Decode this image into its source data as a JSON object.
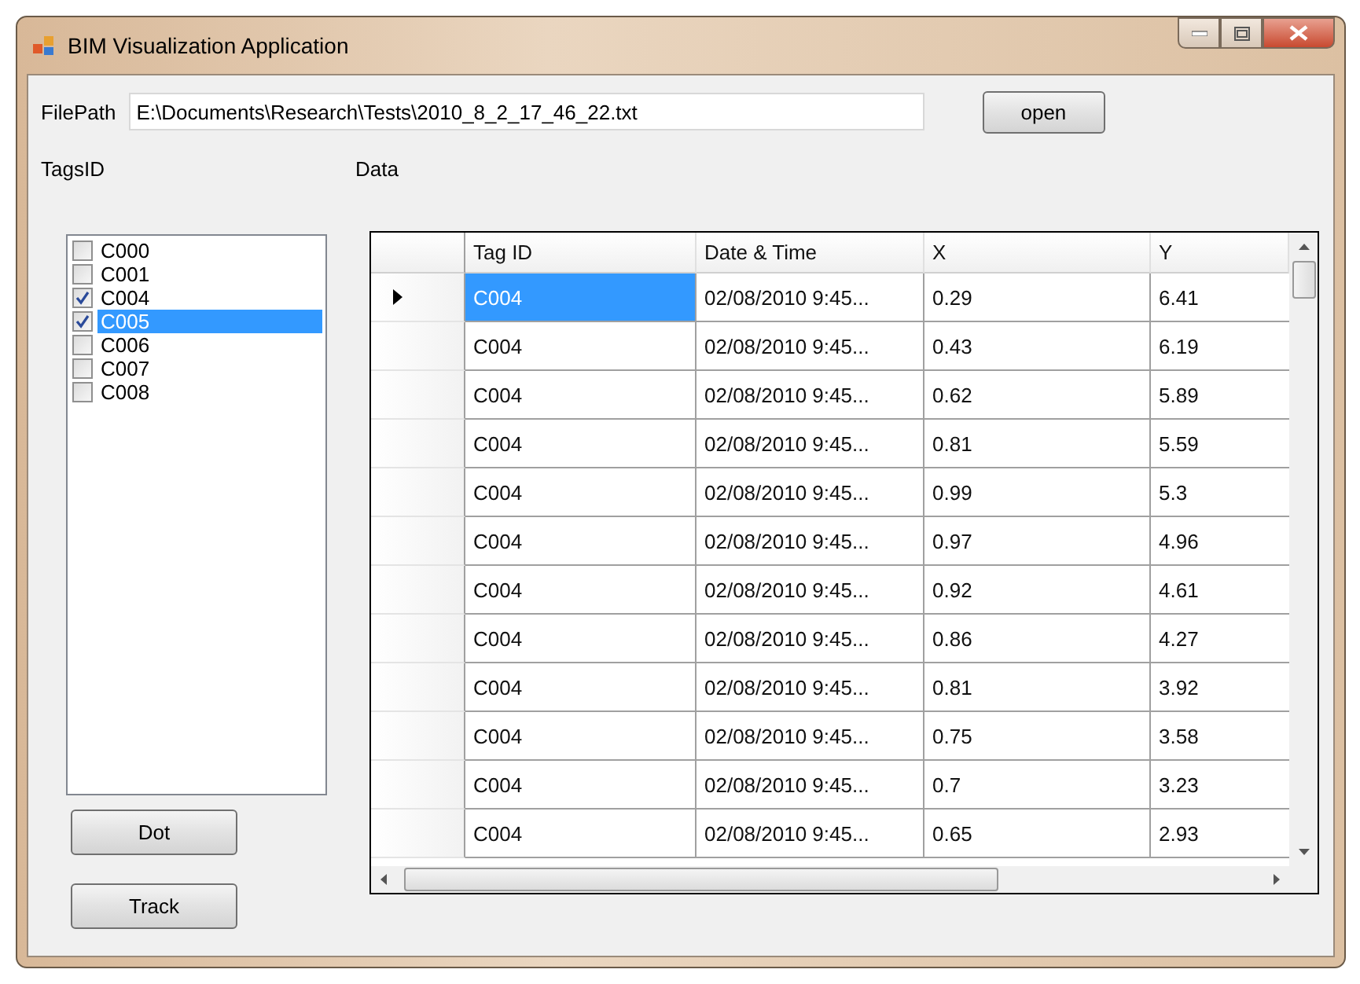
{
  "window": {
    "title": "BIM Visualization Application"
  },
  "file_path": {
    "label": "FilePath",
    "value": "E:\\Documents\\Research\\Tests\\2010_8_2_17_46_22.txt",
    "button": "open"
  },
  "tags_label": "TagsID",
  "data_label": "Data",
  "tags": [
    {
      "label": "C000",
      "checked": false,
      "selected": false
    },
    {
      "label": "C001",
      "checked": false,
      "selected": false
    },
    {
      "label": "C004",
      "checked": true,
      "selected": false
    },
    {
      "label": "C005",
      "checked": true,
      "selected": true
    },
    {
      "label": "C006",
      "checked": false,
      "selected": false
    },
    {
      "label": "C007",
      "checked": false,
      "selected": false
    },
    {
      "label": "C008",
      "checked": false,
      "selected": false
    }
  ],
  "buttons": [
    "Dot",
    "Track"
  ],
  "table": {
    "columns": [
      "Tag ID",
      "Date & Time",
      "X",
      "Y"
    ],
    "rows": [
      {
        "cells": [
          "C004",
          "02/08/2010 9:45...",
          "0.29",
          "6.41"
        ],
        "selected": true
      },
      {
        "cells": [
          "C004",
          "02/08/2010 9:45...",
          "0.43",
          "6.19"
        ],
        "selected": false
      },
      {
        "cells": [
          "C004",
          "02/08/2010 9:45...",
          "0.62",
          "5.89"
        ],
        "selected": false
      },
      {
        "cells": [
          "C004",
          "02/08/2010 9:45...",
          "0.81",
          "5.59"
        ],
        "selected": false
      },
      {
        "cells": [
          "C004",
          "02/08/2010 9:45...",
          "0.99",
          "5.3"
        ],
        "selected": false
      },
      {
        "cells": [
          "C004",
          "02/08/2010 9:45...",
          "0.97",
          "4.96"
        ],
        "selected": false
      },
      {
        "cells": [
          "C004",
          "02/08/2010 9:45...",
          "0.92",
          "4.61"
        ],
        "selected": false
      },
      {
        "cells": [
          "C004",
          "02/08/2010 9:45...",
          "0.86",
          "4.27"
        ],
        "selected": false
      },
      {
        "cells": [
          "C004",
          "02/08/2010 9:45...",
          "0.81",
          "3.92"
        ],
        "selected": false
      },
      {
        "cells": [
          "C004",
          "02/08/2010 9:45...",
          "0.75",
          "3.58"
        ],
        "selected": false
      },
      {
        "cells": [
          "C004",
          "02/08/2010 9:45...",
          "0.7",
          "3.23"
        ],
        "selected": false
      },
      {
        "cells": [
          "C004",
          "02/08/2010 9:45...",
          "0.65",
          "2.93"
        ],
        "selected": false
      }
    ]
  }
}
